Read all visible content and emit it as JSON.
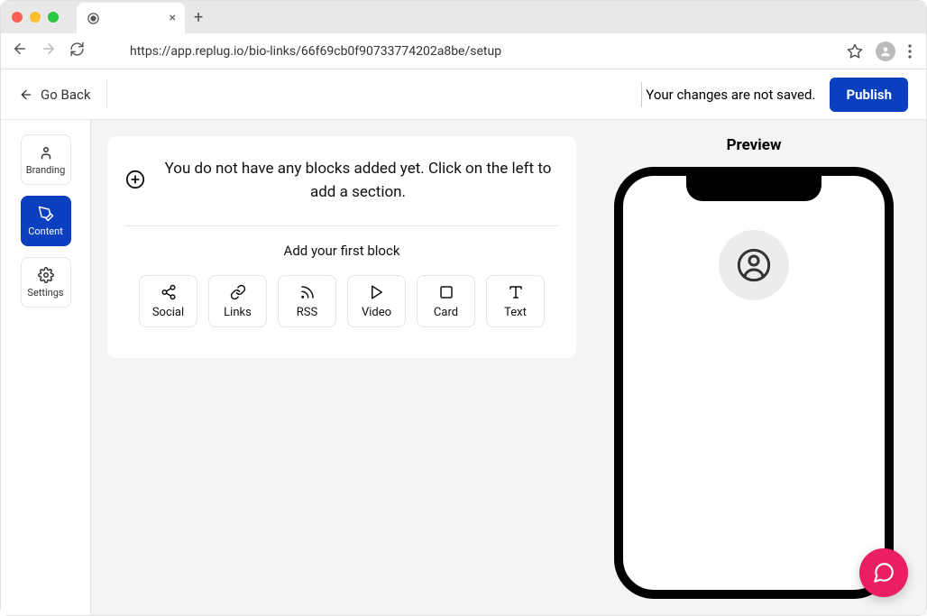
{
  "browser": {
    "url": "https://app.replug.io/bio-links/66f69cb0f90733774202a8be/setup"
  },
  "header": {
    "go_back": "Go Back",
    "save_status": "Your changes are not saved.",
    "publish": "Publish"
  },
  "sidebar": {
    "items": [
      {
        "label": "Branding"
      },
      {
        "label": "Content"
      },
      {
        "label": "Settings"
      }
    ]
  },
  "editor": {
    "empty_message": "You do not have any blocks added yet. Click on the left to add a section.",
    "first_block_label": "Add your first block",
    "blocks": [
      {
        "label": "Social"
      },
      {
        "label": "Links"
      },
      {
        "label": "RSS"
      },
      {
        "label": "Video"
      },
      {
        "label": "Card"
      },
      {
        "label": "Text"
      }
    ]
  },
  "preview": {
    "label": "Preview"
  }
}
